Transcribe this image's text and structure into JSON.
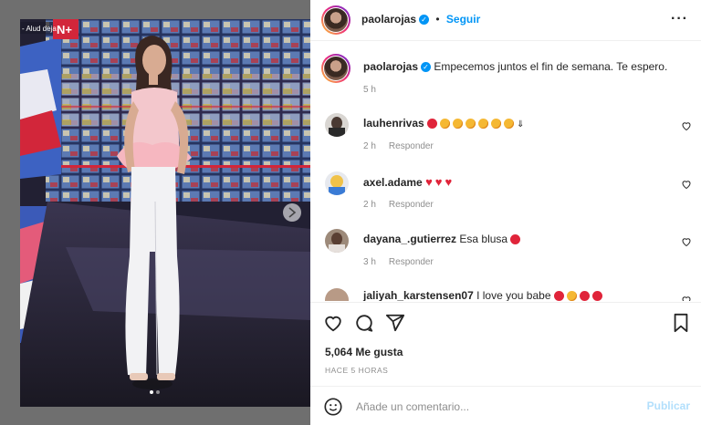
{
  "header": {
    "username": "paolarojas",
    "separator": "•",
    "follow_label": "Seguir"
  },
  "caption": {
    "username": "paolarojas",
    "text": "Empecemos juntos el fin de semana. Te espero.",
    "time": "5 h"
  },
  "comments": [
    {
      "username": "lauhenrivas",
      "text": "",
      "time": "2 h",
      "reply": "Responder"
    },
    {
      "username": "axel.adame",
      "text": "",
      "time": "2 h",
      "reply": "Responder"
    },
    {
      "username": "dayana_.gutierrez",
      "text": "Esa blusa",
      "time": "3 h",
      "reply": "Responder"
    },
    {
      "username": "jaliyah_karstensen07",
      "text": "I love you babe",
      "time": "",
      "reply": ""
    }
  ],
  "post": {
    "likes": "5,064 Me gusta",
    "ago": "HACE 5 HORAS",
    "comment_placeholder": "Añade un comentario...",
    "publish_label": "Publicar"
  },
  "media": {
    "tv_banner": "- Alud deja",
    "carousel_dots": 2,
    "active_dot": 0
  },
  "colors": {
    "accent": "#0095f6",
    "publish_disabled": "#b2dffc",
    "muted": "#8e8e8e"
  },
  "icons": [
    "more-options-icon",
    "heart-icon",
    "comment-icon",
    "share-icon",
    "bookmark-icon",
    "emoji-icon",
    "next-icon",
    "verified-icon"
  ]
}
